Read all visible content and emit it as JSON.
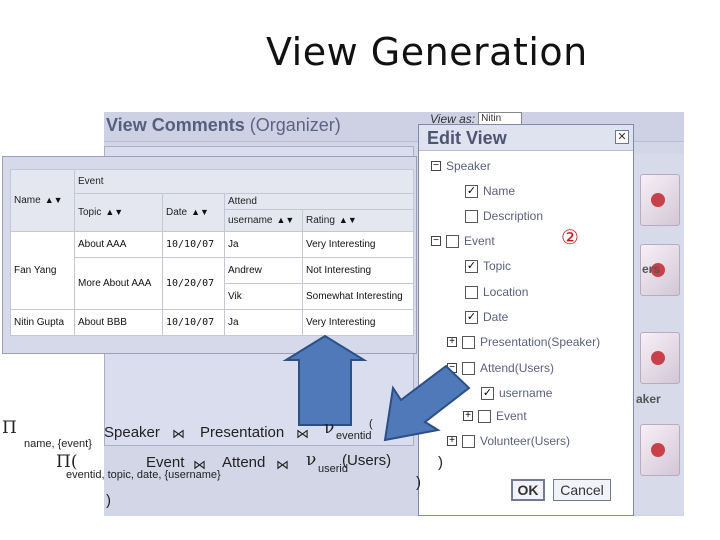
{
  "slide": {
    "title": "View Generation"
  },
  "app": {
    "title": "View Comments",
    "title_suffix": "(Organizer)",
    "view_as_label": "View as:",
    "view_as_value": "Nitin",
    "strip_labels": [
      "ers",
      "aker"
    ]
  },
  "table": {
    "headers": {
      "name": "Name",
      "event": "Event",
      "topic": "Topic",
      "date": "Date",
      "attend": "Attend",
      "username": "username",
      "rating": "Rating",
      "sort_arrows": "▲▼"
    },
    "rows": [
      {
        "name": "",
        "topic": "About AAA",
        "date": "10/10/07",
        "username": "Ja",
        "rating": "Very Interesting"
      },
      {
        "name": "Fan Yang",
        "topic": "",
        "date": "",
        "username": "Andrew",
        "rating": "Not Interesting"
      },
      {
        "name": "",
        "topic": "More About AAA",
        "date": "10/20/07",
        "username": "Vik",
        "rating": "Somewhat Interesting"
      },
      {
        "name": "Nitin Gupta",
        "topic": "About BBB",
        "date": "10/10/07",
        "username": "Ja",
        "rating": "Very Interesting"
      }
    ]
  },
  "dialog": {
    "title": "Edit View",
    "close_glyph": "✕",
    "badge": "②",
    "tree": [
      {
        "label": "Speaker",
        "toggle": "−",
        "checkbox": false,
        "checked": false
      },
      {
        "label": "Name",
        "toggle": "",
        "checkbox": true,
        "checked": true
      },
      {
        "label": "Description",
        "toggle": "",
        "checkbox": true,
        "checked": false
      },
      {
        "label": "Event",
        "toggle": "−",
        "checkbox": true,
        "checked": false
      },
      {
        "label": "Topic",
        "toggle": "",
        "checkbox": true,
        "checked": true
      },
      {
        "label": "Location",
        "toggle": "",
        "checkbox": true,
        "checked": false
      },
      {
        "label": "Date",
        "toggle": "",
        "checkbox": true,
        "checked": true
      },
      {
        "label": "Presentation",
        "suffix": "(Speaker)",
        "toggle": "+",
        "checkbox": true,
        "checked": false
      },
      {
        "label": "Attend",
        "suffix": "(Users)",
        "toggle": "−",
        "checkbox": true,
        "checked": false
      },
      {
        "label": "username",
        "toggle": "",
        "checkbox": true,
        "checked": true
      },
      {
        "label": "Event",
        "toggle": "+",
        "checkbox": true,
        "checked": false
      },
      {
        "label": "Volunteer",
        "suffix": "(Users)",
        "toggle": "+",
        "checkbox": true,
        "checked": false
      }
    ],
    "ok_label": "OK",
    "cancel_label": "Cancel"
  },
  "expression": {
    "pi": "Π",
    "nu": "ν",
    "bowtie": "⋈",
    "name_event": "name, {event}",
    "speaker": "Speaker",
    "presentation": "Presentation",
    "eventid": "eventid",
    "open_paren": "(",
    "pi_open": "Π(",
    "event": "Event",
    "attend": "Attend",
    "userid": "userid",
    "users": "(Users)",
    "proj_attrs": "eventid, topic, date, {username}",
    "close_paren": ")"
  },
  "colors": {
    "arrow": "#4f79b8",
    "arrow_outline": "#2c4f86",
    "badge": "#c01818",
    "app_title": "#55607e"
  }
}
